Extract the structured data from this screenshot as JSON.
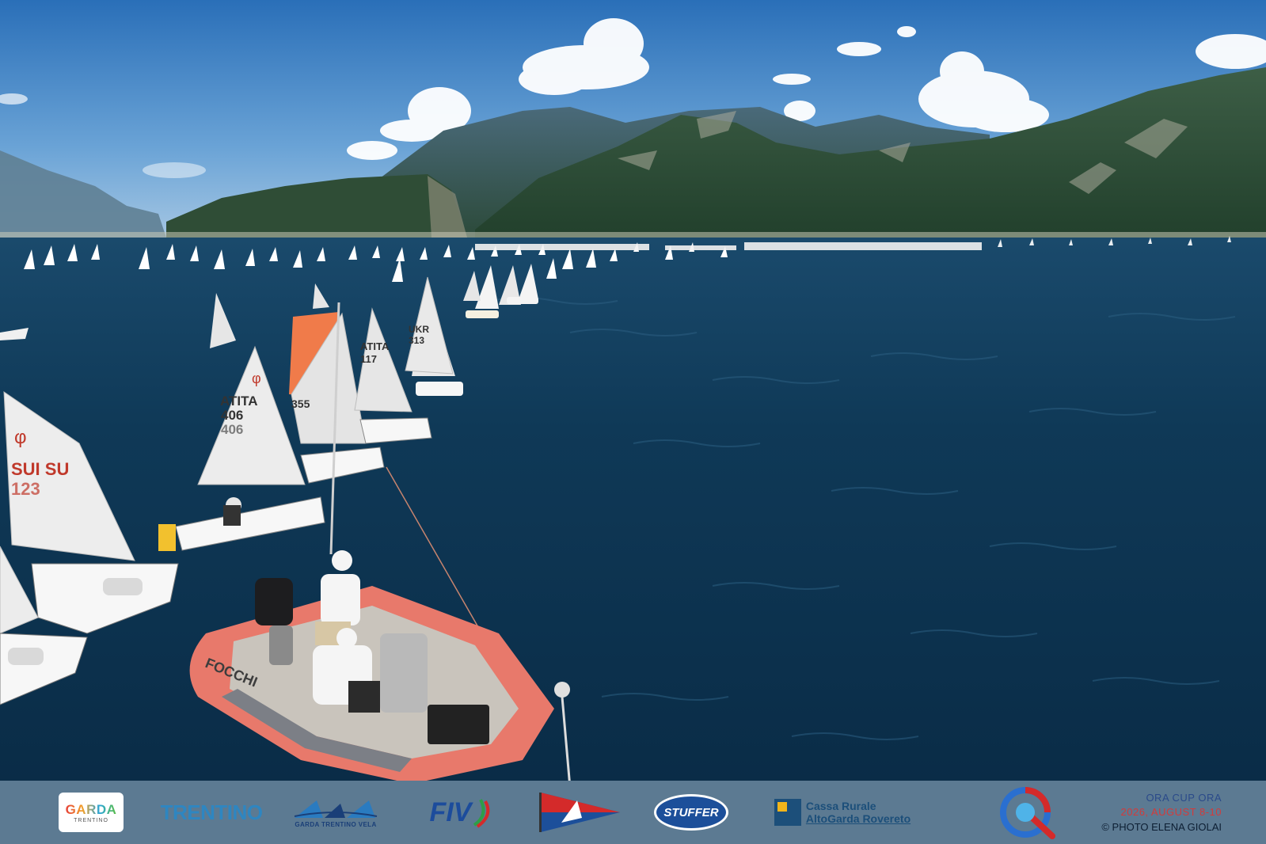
{
  "image": {
    "description_icon": "regatta-photo",
    "sail_numbers": [
      "ITA 406",
      "ITA 117",
      "UKR 313",
      "SUI 123",
      "355"
    ],
    "boat_brand": "FOCCHI"
  },
  "sponsors": {
    "garda": {
      "title": "GARDA",
      "subtitle": "TRENTINO"
    },
    "trentino": {
      "title": "TRENTINO"
    },
    "gtv": {
      "title": "GARDA TRENTINO VELA"
    },
    "fiv": {
      "title": "FIV"
    },
    "stuffer": {
      "title": "STUFFER"
    },
    "cassa": {
      "line1": "Cassa Rurale",
      "line2": "AltoGarda Rovereto"
    }
  },
  "event": {
    "name": "ORA CUP ORA",
    "date": "2026, AUGUST 8-10",
    "credit": "© PHOTO ELENA GIOLAI"
  },
  "colors": {
    "sky_top": "#2a6fb8",
    "lake": "#0d3550",
    "dinghy": "#e8786a",
    "red_text": "#d23b3b",
    "blue_text": "#2a4a8a"
  }
}
